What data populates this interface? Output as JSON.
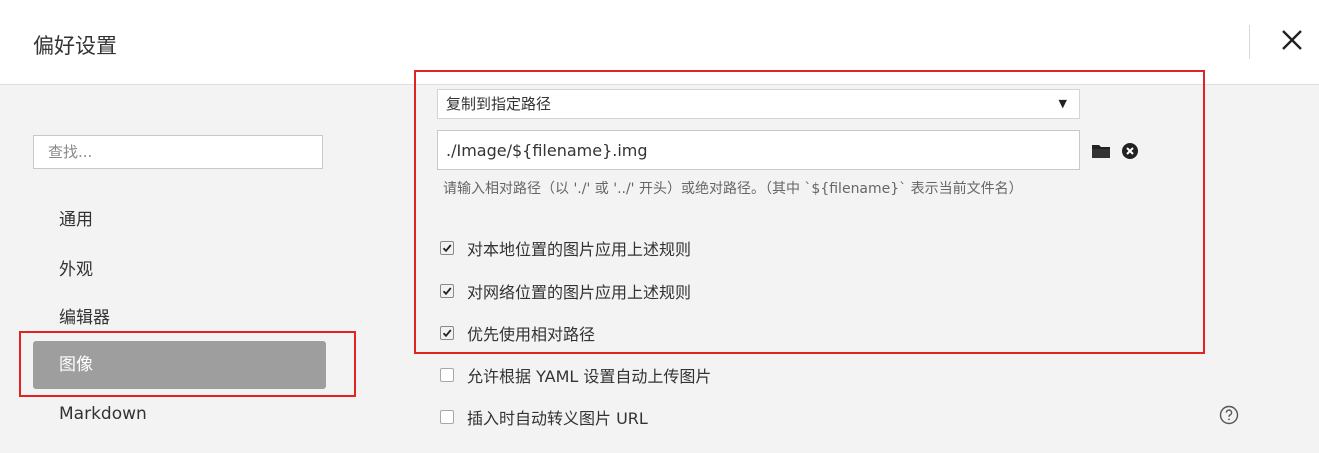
{
  "dialog": {
    "title": "偏好设置"
  },
  "sidebar": {
    "search_placeholder": "查找...",
    "items": [
      {
        "label": "通用",
        "active": false
      },
      {
        "label": "外观",
        "active": false
      },
      {
        "label": "编辑器",
        "active": false
      },
      {
        "label": "图像",
        "active": true
      },
      {
        "label": "Markdown",
        "active": false
      }
    ]
  },
  "image_settings": {
    "insert_action": "复制到指定路径",
    "path_value": "./Image/${filename}.img",
    "hint": "请输入相对路径（以 './' 或 '../' 开头）或绝对路径。（其中 `${filename}` 表示当前文件名）",
    "options": [
      {
        "label": "对本地位置的图片应用上述规则",
        "checked": true
      },
      {
        "label": "对网络位置的图片应用上述规则",
        "checked": true
      },
      {
        "label": "优先使用相对路径",
        "checked": true
      },
      {
        "label": "允许根据 YAML 设置自动上传图片",
        "checked": false
      },
      {
        "label": "插入时自动转义图片 URL",
        "checked": false
      }
    ]
  },
  "icons": {
    "close": "close-icon",
    "folder": "folder-icon",
    "clear": "clear-circle-icon",
    "help": "help-circle-icon",
    "dropdown": "dropdown-arrow-icon"
  },
  "colors": {
    "highlight_border": "#e02424",
    "active_nav_bg": "#9e9e9e"
  }
}
